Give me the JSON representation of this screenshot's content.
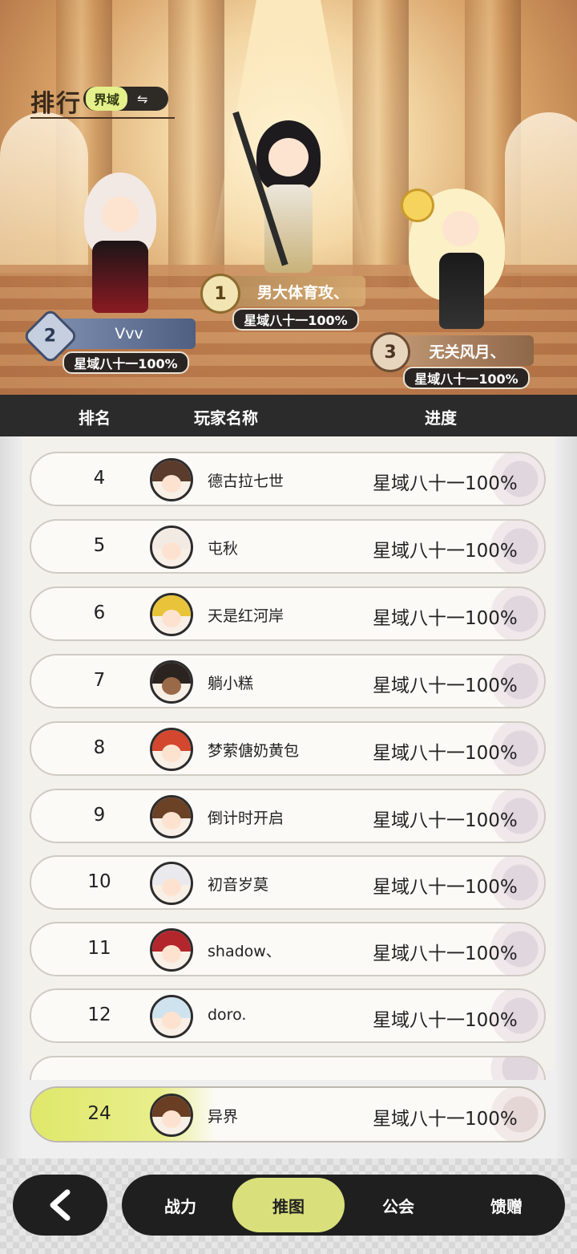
{
  "header": {
    "title": "排行",
    "realm_toggle": "界域",
    "swap_icon": "⇋"
  },
  "podium": {
    "first": {
      "rank": "1",
      "name": "男大体育攻、",
      "progress": "星域八十一100%"
    },
    "second": {
      "rank": "2",
      "name": "Vvv",
      "progress": "星域八十一100%"
    },
    "third": {
      "rank": "3",
      "name": "无关风月、",
      "progress": "星域八十一100%"
    }
  },
  "table_header": {
    "rank": "排名",
    "player": "玩家名称",
    "progress": "进度"
  },
  "rows": [
    {
      "rank": "4",
      "name": "德古拉七世",
      "progress": "星域八十一100%"
    },
    {
      "rank": "5",
      "name": "屯秋",
      "progress": "星域八十一100%"
    },
    {
      "rank": "6",
      "name": "天是红河岸",
      "progress": "星域八十一100%"
    },
    {
      "rank": "7",
      "name": "躺小糕",
      "progress": "星域八十一100%"
    },
    {
      "rank": "8",
      "name": "梦萦傏奶黄包",
      "progress": "星域八十一100%"
    },
    {
      "rank": "9",
      "name": "倒计时开启",
      "progress": "星域八十一100%"
    },
    {
      "rank": "10",
      "name": "初音岁莫",
      "progress": "星域八十一100%"
    },
    {
      "rank": "11",
      "name": "shadow、",
      "progress": "星域八十一100%"
    },
    {
      "rank": "12",
      "name": "doro.",
      "progress": "星域八十一100%"
    }
  ],
  "my_row": {
    "rank": "24",
    "name": "异界",
    "progress": "星域八十一100%"
  },
  "nav": {
    "back_icon": "chevron-left-icon",
    "tabs": [
      "战力",
      "推图",
      "公会",
      "馈赠"
    ],
    "active_tab": "推图"
  },
  "colors": {
    "accent_green": "#d9df7b",
    "dark": "#1f1f1f",
    "my_row_highlight": "#dfe86a"
  }
}
